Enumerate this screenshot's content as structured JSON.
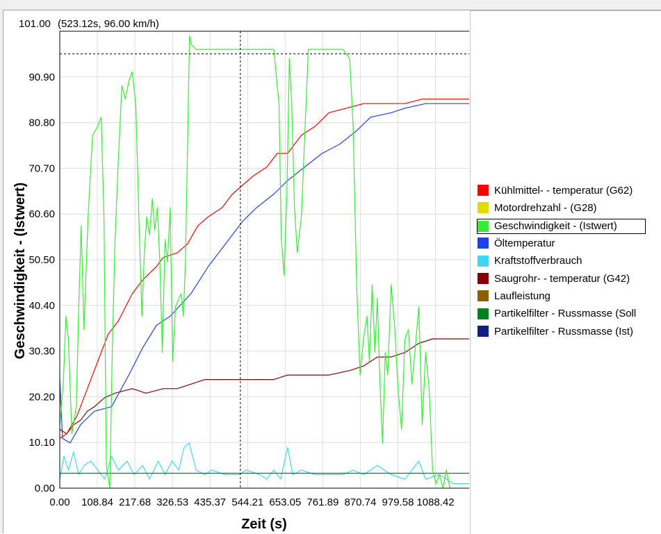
{
  "chart_data": {
    "type": "line",
    "cursor_readout": "(523.12s, 96.00 km/h)",
    "xlabel": "Zeit (s)",
    "ylabel": "Geschwindigkeit - (Istwert)",
    "xlim": [
      0,
      1188
    ],
    "ylim": [
      0,
      101
    ],
    "x_ticks": [
      "0.00",
      "108.84",
      "217.68",
      "326.53",
      "435.37",
      "544.21",
      "653.05",
      "761.89",
      "870.74",
      "979.58",
      "1088.42"
    ],
    "y_ticks": [
      "0.00",
      "10.10",
      "20.20",
      "30.30",
      "40.40",
      "50.50",
      "60.60",
      "70.70",
      "80.80",
      "90.90",
      "101.00"
    ],
    "cursor": {
      "x": 523.12,
      "y": 96.0
    },
    "grid": true,
    "legend_position": "right",
    "series": [
      {
        "name": "Kühlmittel- - temperatur (G62)",
        "color": "#ff0000",
        "values": [
          [
            0,
            11
          ],
          [
            20,
            12
          ],
          [
            50,
            16
          ],
          [
            80,
            22
          ],
          [
            110,
            28
          ],
          [
            140,
            34
          ],
          [
            170,
            37
          ],
          [
            210,
            43
          ],
          [
            240,
            46
          ],
          [
            280,
            49
          ],
          [
            300,
            51
          ],
          [
            340,
            52
          ],
          [
            370,
            54
          ],
          [
            400,
            58
          ],
          [
            430,
            60
          ],
          [
            470,
            62
          ],
          [
            500,
            65
          ],
          [
            530,
            67
          ],
          [
            560,
            69
          ],
          [
            600,
            71
          ],
          [
            630,
            74
          ],
          [
            660,
            74
          ],
          [
            700,
            78
          ],
          [
            740,
            80
          ],
          [
            780,
            83
          ],
          [
            830,
            84
          ],
          [
            880,
            85
          ],
          [
            940,
            85
          ],
          [
            1000,
            85
          ],
          [
            1050,
            86
          ],
          [
            1100,
            86
          ],
          [
            1188,
            86
          ]
        ]
      },
      {
        "name": "Motordrehzahl - (G28)",
        "color": "#dddd00",
        "values": []
      },
      {
        "name": "Geschwindigkeit - (Istwert)",
        "color": "#33ee33",
        "values": [
          [
            0,
            14
          ],
          [
            10,
            23
          ],
          [
            18,
            38
          ],
          [
            25,
            33
          ],
          [
            35,
            12
          ],
          [
            48,
            18
          ],
          [
            55,
            40
          ],
          [
            62,
            58
          ],
          [
            70,
            35
          ],
          [
            82,
            60
          ],
          [
            95,
            78
          ],
          [
            110,
            80
          ],
          [
            120,
            82
          ],
          [
            128,
            60
          ],
          [
            135,
            5
          ],
          [
            145,
            0
          ],
          [
            152,
            30
          ],
          [
            160,
            55
          ],
          [
            170,
            73
          ],
          [
            180,
            89
          ],
          [
            190,
            86
          ],
          [
            200,
            90
          ],
          [
            210,
            92
          ],
          [
            220,
            85
          ],
          [
            230,
            58
          ],
          [
            238,
            38
          ],
          [
            245,
            52
          ],
          [
            252,
            60
          ],
          [
            260,
            56
          ],
          [
            268,
            64
          ],
          [
            275,
            57
          ],
          [
            283,
            62
          ],
          [
            290,
            50
          ],
          [
            297,
            30
          ],
          [
            305,
            55
          ],
          [
            312,
            50
          ],
          [
            320,
            62
          ],
          [
            327,
            28
          ],
          [
            335,
            40
          ],
          [
            345,
            42
          ],
          [
            352,
            43
          ],
          [
            358,
            38
          ],
          [
            364,
            50
          ],
          [
            370,
            75
          ],
          [
            376,
            100
          ],
          [
            382,
            98
          ],
          [
            395,
            97
          ],
          [
            430,
            97
          ],
          [
            470,
            97
          ],
          [
            500,
            97
          ],
          [
            540,
            97
          ],
          [
            580,
            97
          ],
          [
            620,
            97
          ],
          [
            635,
            85
          ],
          [
            642,
            55
          ],
          [
            650,
            47
          ],
          [
            658,
            65
          ],
          [
            665,
            95
          ],
          [
            672,
            85
          ],
          [
            680,
            62
          ],
          [
            688,
            52
          ],
          [
            700,
            60
          ],
          [
            720,
            97
          ],
          [
            760,
            97
          ],
          [
            820,
            97
          ],
          [
            840,
            95
          ],
          [
            850,
            80
          ],
          [
            860,
            45
          ],
          [
            870,
            25
          ],
          [
            880,
            33
          ],
          [
            890,
            38
          ],
          [
            897,
            28
          ],
          [
            905,
            45
          ],
          [
            913,
            30
          ],
          [
            920,
            42
          ],
          [
            927,
            24
          ],
          [
            935,
            10
          ],
          [
            943,
            30
          ],
          [
            950,
            25
          ],
          [
            960,
            45
          ],
          [
            970,
            36
          ],
          [
            980,
            22
          ],
          [
            990,
            13
          ],
          [
            1000,
            33
          ],
          [
            1010,
            35
          ],
          [
            1020,
            23
          ],
          [
            1030,
            31
          ],
          [
            1040,
            40
          ],
          [
            1050,
            14
          ],
          [
            1060,
            30
          ],
          [
            1070,
            22
          ],
          [
            1080,
            4
          ],
          [
            1090,
            1
          ],
          [
            1100,
            3
          ],
          [
            1110,
            0
          ],
          [
            1120,
            4
          ],
          [
            1130,
            0
          ]
        ]
      },
      {
        "name": "Öltemperatur",
        "color": "#2040ee",
        "values": [
          [
            0,
            24
          ],
          [
            8,
            11
          ],
          [
            30,
            10
          ],
          [
            60,
            14
          ],
          [
            100,
            17
          ],
          [
            150,
            18
          ],
          [
            200,
            25
          ],
          [
            240,
            31
          ],
          [
            280,
            36
          ],
          [
            320,
            38
          ],
          [
            380,
            43
          ],
          [
            430,
            49
          ],
          [
            480,
            54
          ],
          [
            530,
            59
          ],
          [
            570,
            62
          ],
          [
            620,
            65
          ],
          [
            660,
            68
          ],
          [
            710,
            71
          ],
          [
            760,
            74
          ],
          [
            810,
            76
          ],
          [
            860,
            79
          ],
          [
            900,
            82
          ],
          [
            960,
            83
          ],
          [
            1000,
            84
          ],
          [
            1060,
            85
          ],
          [
            1100,
            85
          ],
          [
            1188,
            85
          ]
        ]
      },
      {
        "name": "Kraftstoffverbrauch",
        "color": "#40d8f0",
        "values": [
          [
            0,
            2
          ],
          [
            12,
            7
          ],
          [
            25,
            4
          ],
          [
            40,
            8
          ],
          [
            55,
            3
          ],
          [
            70,
            5
          ],
          [
            90,
            6
          ],
          [
            110,
            4
          ],
          [
            130,
            2
          ],
          [
            150,
            7
          ],
          [
            170,
            4
          ],
          [
            195,
            6
          ],
          [
            215,
            3
          ],
          [
            240,
            5
          ],
          [
            260,
            2
          ],
          [
            285,
            6
          ],
          [
            305,
            3
          ],
          [
            325,
            6
          ],
          [
            345,
            4
          ],
          [
            360,
            9
          ],
          [
            375,
            10
          ],
          [
            395,
            4
          ],
          [
            420,
            3
          ],
          [
            440,
            4
          ],
          [
            480,
            3
          ],
          [
            520,
            3
          ],
          [
            540,
            4
          ],
          [
            580,
            3
          ],
          [
            600,
            2
          ],
          [
            620,
            4
          ],
          [
            640,
            2
          ],
          [
            660,
            9
          ],
          [
            675,
            3
          ],
          [
            700,
            4
          ],
          [
            740,
            3
          ],
          [
            780,
            3
          ],
          [
            820,
            3
          ],
          [
            850,
            4
          ],
          [
            880,
            3
          ],
          [
            920,
            5
          ],
          [
            960,
            3
          ],
          [
            1000,
            2
          ],
          [
            1040,
            6
          ],
          [
            1060,
            2
          ],
          [
            1100,
            3
          ],
          [
            1140,
            1
          ],
          [
            1188,
            1
          ]
        ]
      },
      {
        "name": "Saugrohr- - temperatur (G42)",
        "color": "#880000",
        "values": [
          [
            0,
            13
          ],
          [
            20,
            12
          ],
          [
            40,
            14
          ],
          [
            60,
            15
          ],
          [
            80,
            17
          ],
          [
            100,
            18
          ],
          [
            130,
            20
          ],
          [
            160,
            21
          ],
          [
            210,
            22
          ],
          [
            250,
            21
          ],
          [
            300,
            22
          ],
          [
            340,
            22
          ],
          [
            380,
            23
          ],
          [
            420,
            24
          ],
          [
            460,
            24
          ],
          [
            500,
            24
          ],
          [
            560,
            24
          ],
          [
            620,
            24
          ],
          [
            660,
            25
          ],
          [
            720,
            25
          ],
          [
            780,
            25
          ],
          [
            840,
            26
          ],
          [
            880,
            27
          ],
          [
            920,
            29
          ],
          [
            960,
            29
          ],
          [
            1000,
            30
          ],
          [
            1040,
            32
          ],
          [
            1080,
            33
          ],
          [
            1120,
            33
          ],
          [
            1188,
            33
          ]
        ]
      },
      {
        "name": "Laufleistung",
        "color": "#8b6000",
        "values": []
      },
      {
        "name": "Partikelfilter - Russmasse (Soll",
        "color": "#00801e",
        "values": [
          [
            0,
            3.3
          ],
          [
            1188,
            3.3
          ]
        ]
      },
      {
        "name": "Partikelfilter - Russmasse (Ist)",
        "color": "#102080",
        "values": []
      }
    ]
  }
}
